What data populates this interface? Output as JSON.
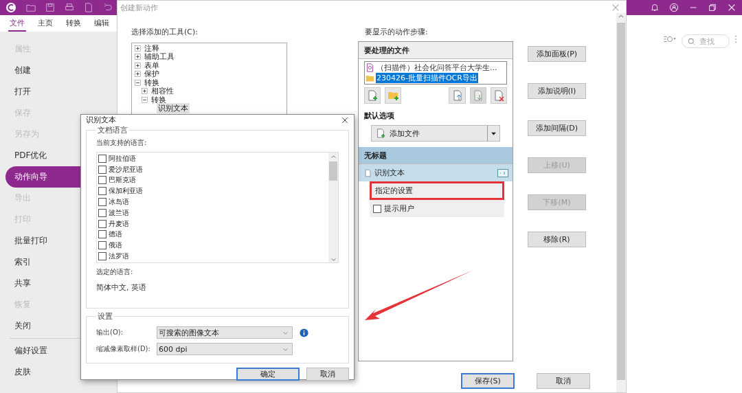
{
  "app": {
    "tabs": [
      {
        "label": "文件",
        "selected": true
      },
      {
        "label": "主页",
        "selected": false
      },
      {
        "label": "转换",
        "selected": false
      },
      {
        "label": "编辑",
        "selected": false
      }
    ],
    "sidebar": {
      "items": [
        {
          "label": "属性",
          "disabled": true,
          "selected": false
        },
        {
          "label": "创建",
          "disabled": false,
          "selected": false
        },
        {
          "label": "打开",
          "disabled": false,
          "selected": false
        },
        {
          "label": "保存",
          "disabled": true,
          "selected": false
        },
        {
          "label": "另存为",
          "disabled": true,
          "selected": false
        },
        {
          "label": "PDF优化",
          "disabled": false,
          "selected": false
        },
        {
          "label": "动作向导",
          "disabled": false,
          "selected": true
        },
        {
          "label": "导出",
          "disabled": true,
          "selected": false
        },
        {
          "label": "打印",
          "disabled": true,
          "selected": false
        },
        {
          "label": "批量打印",
          "disabled": false,
          "selected": false
        },
        {
          "label": "索引",
          "disabled": false,
          "selected": false
        },
        {
          "label": "共享",
          "disabled": false,
          "selected": false
        },
        {
          "label": "恢复",
          "disabled": true,
          "selected": false
        },
        {
          "label": "关闭",
          "disabled": false,
          "selected": false
        }
      ],
      "bottom_items": [
        {
          "label": "偏好设置",
          "disabled": false,
          "selected": false
        },
        {
          "label": "皮肤",
          "disabled": false,
          "selected": false
        }
      ]
    },
    "search": {
      "placeholder": "查找"
    }
  },
  "action_dialog": {
    "title": "创建新动作",
    "tools_label": "选择添加的工具(C):",
    "tools_tree": [
      {
        "label": "注释",
        "expanded": false,
        "selected": false
      },
      {
        "label": "辅助工具",
        "expanded": false,
        "selected": false
      },
      {
        "label": "表单",
        "expanded": false,
        "selected": false
      },
      {
        "label": "保护",
        "expanded": false,
        "selected": false
      },
      {
        "label": "转换",
        "expanded": true,
        "selected": false,
        "children": [
          {
            "label": "相容性",
            "expanded": false,
            "selected": false
          },
          {
            "label": "转换",
            "expanded": true,
            "selected": false,
            "children": [
              {
                "label": "识别文本",
                "selected": true
              }
            ]
          }
        ]
      }
    ],
    "steps_label": "要显示的动作步骤:",
    "files_header": "要处理的文件",
    "files": [
      {
        "name": "（扫描件）社会化问答平台大学生...",
        "kind": "pdf",
        "selected": false
      },
      {
        "name": "230426-批量扫描件OCR导出",
        "kind": "folder",
        "selected": true
      }
    ],
    "default_options_header": "默认选项",
    "add_file": {
      "value": "添加文件"
    },
    "group_header": "无标题",
    "step": {
      "label": "识别文本"
    },
    "step_options": [
      {
        "label": "指定的设置",
        "kind": "setting",
        "highlighted": true
      },
      {
        "label": "提示用户",
        "kind": "checkbox",
        "checked": false
      }
    ],
    "side_buttons": [
      {
        "label": "添加面板(P)",
        "disabled": false
      },
      {
        "label": "添加说明(I)",
        "disabled": false
      },
      {
        "label": "添加间隔(D)",
        "disabled": false
      },
      {
        "label": "上移(U)",
        "disabled": true
      },
      {
        "label": "下移(M)",
        "disabled": true
      },
      {
        "label": "移除(R)",
        "disabled": false
      }
    ],
    "footer_buttons": [
      {
        "label": "保存(S)",
        "default": true
      },
      {
        "label": "取消",
        "default": false
      }
    ]
  },
  "ocr_dialog": {
    "title": "识别文本",
    "language_group": "文档语言",
    "supported_label": "当前支持的语言:",
    "languages": [
      {
        "label": "阿拉伯语",
        "checked": false
      },
      {
        "label": "爱沙尼亚语",
        "checked": false
      },
      {
        "label": "巴斯克语",
        "checked": false
      },
      {
        "label": "保加利亚语",
        "checked": false
      },
      {
        "label": "冰岛语",
        "checked": false
      },
      {
        "label": "波兰语",
        "checked": false
      },
      {
        "label": "丹麦语",
        "checked": false
      },
      {
        "label": "德语",
        "checked": false
      },
      {
        "label": "俄语",
        "checked": false
      },
      {
        "label": "法罗语",
        "checked": false
      }
    ],
    "selected_label": "选定的语言:",
    "selected_value": "简体中文, 英语",
    "settings_group": "设置",
    "output": {
      "label": "输出(O):",
      "value": "可搜索的图像文本"
    },
    "downsample": {
      "label": "缩减像素取样(D):",
      "value": "600 dpi"
    },
    "buttons": [
      {
        "label": "确定",
        "default": true
      },
      {
        "label": "取消",
        "default": false
      }
    ]
  }
}
